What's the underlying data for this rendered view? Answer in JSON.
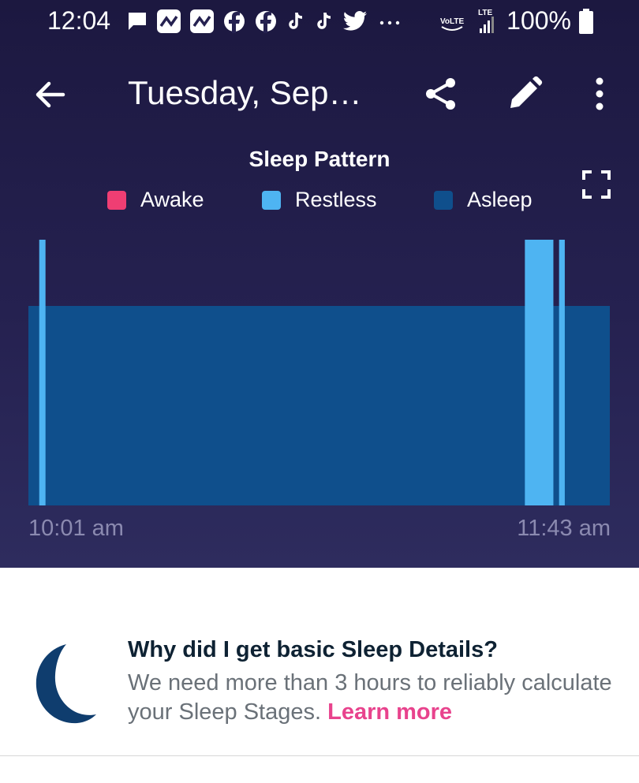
{
  "status_bar": {
    "time": "12:04",
    "battery": "100%",
    "network": "LTE"
  },
  "app_bar": {
    "title": "Tuesday, Sep…"
  },
  "chart_data": {
    "type": "area",
    "title": "Sleep Pattern",
    "legend": [
      {
        "name": "Awake",
        "color": "#ef3e73"
      },
      {
        "name": "Restless",
        "color": "#4eb4f2"
      },
      {
        "name": "Asleep",
        "color": "#0f4f8c"
      }
    ],
    "x_start": "10:01 am",
    "x_end": "11:43 am",
    "x_range_minutes": [
      0,
      102
    ],
    "levels": {
      "Asleep": 1,
      "Restless": 2
    },
    "segments": [
      {
        "state": "Asleep",
        "start_min": 0,
        "end_min": 102
      },
      {
        "state": "Restless",
        "start_min": 1.9,
        "end_min": 3.0
      },
      {
        "state": "Restless",
        "start_min": 87.1,
        "end_min": 92.1
      },
      {
        "state": "Restless",
        "start_min": 93.1,
        "end_min": 94.1
      }
    ]
  },
  "info": {
    "heading": "Why did I get basic Sleep Details?",
    "body": "We need more than 3 hours to reliably calculate your Sleep Stages.",
    "link": "Learn more"
  },
  "icons": {
    "back": "arrow-back-icon",
    "share": "share-icon",
    "edit": "pencil-icon",
    "more": "more-vertical-icon",
    "fullscreen": "fullscreen-icon",
    "moon": "moon-icon"
  }
}
